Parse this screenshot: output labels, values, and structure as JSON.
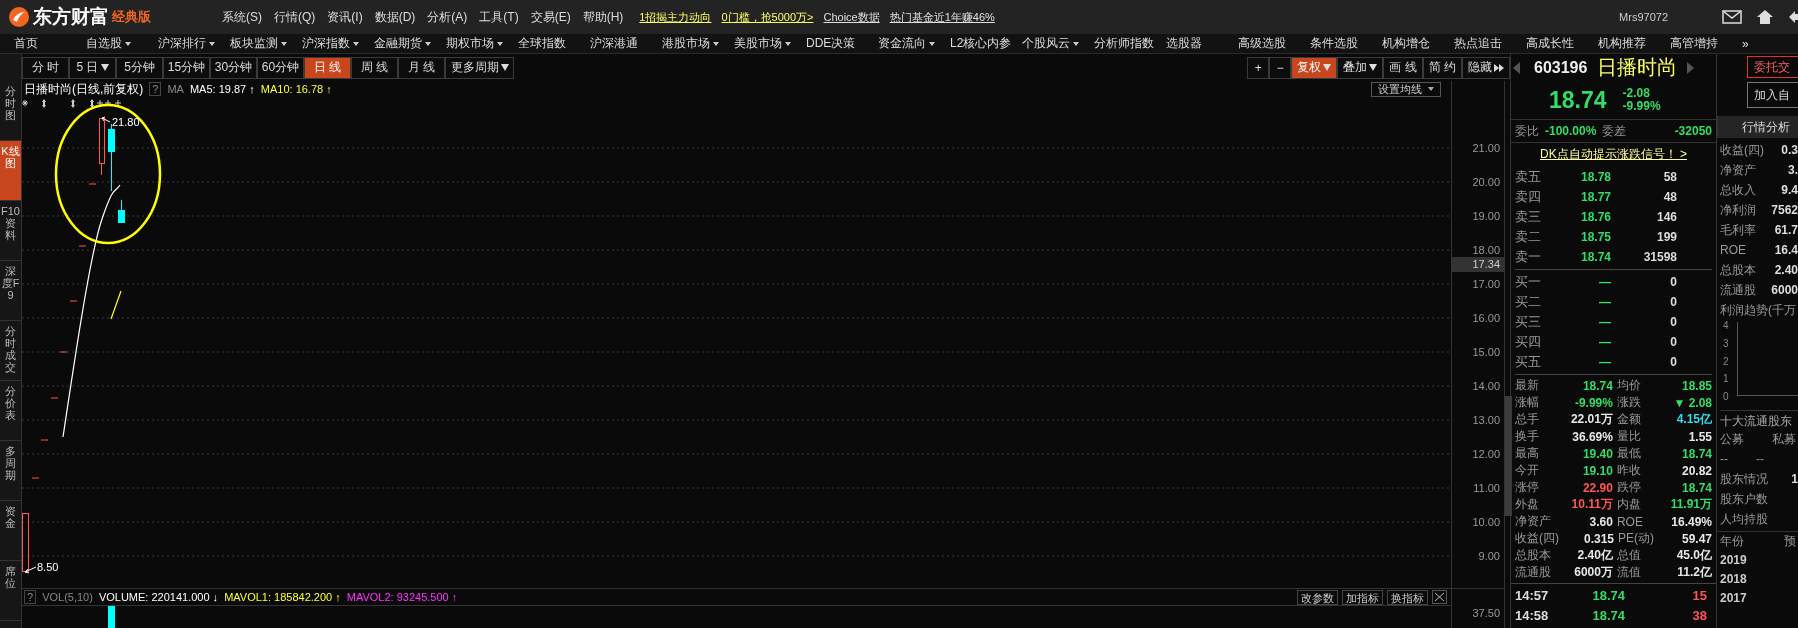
{
  "app": {
    "brand": "东方财富",
    "edition": "经典版"
  },
  "menu": [
    "系统(S)",
    "行情(Q)",
    "资讯(I)",
    "数据(D)",
    "分析(A)",
    "工具(T)",
    "交易(E)",
    "帮助(H)"
  ],
  "promo_links": [
    {
      "label": "1招揭主力动向",
      "color": "#ffff66"
    },
    {
      "label": "0门槛，抢5000万>",
      "color": "#ffff66"
    },
    {
      "label": "Choice数据",
      "color": "#e0e0e0"
    },
    {
      "label": "热门基金近1年赚46%",
      "color": "#e0e0e0"
    }
  ],
  "user": "Mrs97072",
  "nav": [
    {
      "label": "首页",
      "dropdown": false
    },
    {
      "label": "自选股",
      "dropdown": true
    },
    {
      "label": "沪深排行",
      "dropdown": true
    },
    {
      "label": "板块监测",
      "dropdown": true
    },
    {
      "label": "沪深指数",
      "dropdown": true
    },
    {
      "label": "金融期货",
      "dropdown": true
    },
    {
      "label": "期权市场",
      "dropdown": true
    },
    {
      "label": "全球指数",
      "dropdown": false
    },
    {
      "label": "沪深港通",
      "dropdown": false
    },
    {
      "label": "港股市场",
      "dropdown": true
    },
    {
      "label": "美股市场",
      "dropdown": true
    },
    {
      "label": "DDE决策",
      "dropdown": false
    },
    {
      "label": "资金流向",
      "dropdown": true
    },
    {
      "label": "L2核心内参",
      "dropdown": false
    },
    {
      "label": "个股风云",
      "dropdown": true
    },
    {
      "label": "分析师指数",
      "dropdown": false
    },
    {
      "label": "选股器",
      "dropdown": false
    },
    {
      "label": "高级选股",
      "dropdown": false
    },
    {
      "label": "条件选股",
      "dropdown": false
    },
    {
      "label": "机构增仓",
      "dropdown": false
    },
    {
      "label": "热点追击",
      "dropdown": false
    },
    {
      "label": "高成长性",
      "dropdown": false
    },
    {
      "label": "机构推荐",
      "dropdown": false
    },
    {
      "label": "高管增持",
      "dropdown": false
    },
    {
      "label": "»",
      "dropdown": false
    }
  ],
  "side_tabs": [
    {
      "label": "分时图",
      "selected": false
    },
    {
      "label": "K线图",
      "selected": true
    },
    {
      "label": "F10资料",
      "selected": false
    },
    {
      "label": "深度F9",
      "selected": false
    },
    {
      "label": "分时成交",
      "selected": false
    },
    {
      "label": "分价表",
      "selected": false
    },
    {
      "label": "多周期",
      "selected": false
    },
    {
      "label": "资金",
      "selected": false
    },
    {
      "label": "席位",
      "selected": false
    }
  ],
  "periods": [
    {
      "label": "分 时",
      "selected": false,
      "dropdown": false
    },
    {
      "label": "5 日",
      "selected": false,
      "dropdown": true
    },
    {
      "label": "5分钟",
      "selected": false,
      "dropdown": false
    },
    {
      "label": "15分钟",
      "selected": false,
      "dropdown": false
    },
    {
      "label": "30分钟",
      "selected": false,
      "dropdown": false
    },
    {
      "label": "60分钟",
      "selected": false,
      "dropdown": false
    },
    {
      "label": "日 线",
      "selected": true,
      "dropdown": false
    },
    {
      "label": "周 线",
      "selected": false,
      "dropdown": false
    },
    {
      "label": "月 线",
      "selected": false,
      "dropdown": false
    },
    {
      "label": "更多周期",
      "selected": false,
      "dropdown": true
    }
  ],
  "chart_tools": [
    {
      "label": "+",
      "selected": false,
      "kind": "plain"
    },
    {
      "label": "−",
      "selected": false,
      "kind": "plain"
    },
    {
      "label": "复权",
      "selected": true,
      "kind": "dropdown"
    },
    {
      "label": "叠加",
      "selected": false,
      "kind": "dropdown"
    },
    {
      "label": "画 线",
      "selected": false,
      "kind": "plain"
    },
    {
      "label": "简 约",
      "selected": false,
      "kind": "plain"
    },
    {
      "label": "隐藏",
      "selected": false,
      "kind": "expand"
    }
  ],
  "chart": {
    "title": "日播时尚",
    "subtitle": "(日线,前复权)",
    "help": "?",
    "ma_label": "MA",
    "ma": [
      {
        "text": "MA5: 19.87 ↑",
        "color": "#ffffff"
      },
      {
        "text": "MA10: 16.78 ↑",
        "color": "#ffff33"
      }
    ],
    "ma_setting": "设置均线",
    "high_label": "21.80",
    "low_label": "8.50",
    "price_axis": [
      "21.00",
      "20.00",
      "19.00",
      "18.00",
      "17.00",
      "16.00",
      "15.00",
      "14.00",
      "13.00",
      "12.00",
      "11.00",
      "10.00",
      "9.00"
    ],
    "current_price_tag": "17.34"
  },
  "volume": {
    "help": "?",
    "name": "VOL(5,10)",
    "values": [
      {
        "text": "VOLUME: 220141.000 ↓",
        "color": "#ffffff"
      },
      {
        "text": "MAVOL1: 185842.200 ↑",
        "color": "#ffff33"
      },
      {
        "text": "MAVOL2: 93245.500 ↑",
        "color": "#ff33ff"
      }
    ],
    "buttons": [
      "改参数",
      "加指标",
      "换指标"
    ],
    "axis": "37.50"
  },
  "quote": {
    "code": "603196",
    "name": "日播时尚",
    "price": "18.74",
    "change": "-2.08",
    "change_pct": "-9.99%",
    "ratio_label": "委比",
    "ratio": "-100.00%",
    "diff_label": "委差",
    "diff": "-32050",
    "signal_link": "DK点自动提示涨跌信号！ >",
    "asks": [
      {
        "label": "卖五",
        "price": "18.78",
        "volume": "58"
      },
      {
        "label": "卖四",
        "price": "18.77",
        "volume": "48"
      },
      {
        "label": "卖三",
        "price": "18.76",
        "volume": "146"
      },
      {
        "label": "卖二",
        "price": "18.75",
        "volume": "199"
      },
      {
        "label": "卖一",
        "price": "18.74",
        "volume": "31598"
      }
    ],
    "bids": [
      {
        "label": "买一",
        "price": "—",
        "volume": "0"
      },
      {
        "label": "买二",
        "price": "—",
        "volume": "0"
      },
      {
        "label": "买三",
        "price": "—",
        "volume": "0"
      },
      {
        "label": "买四",
        "price": "—",
        "volume": "0"
      },
      {
        "label": "买五",
        "price": "—",
        "volume": "0"
      }
    ],
    "stats": [
      {
        "cells": [
          {
            "label": "最新",
            "value": "18.74",
            "color": "#33dd66"
          },
          {
            "label": "均价",
            "value": "18.85",
            "color": "#33dd66"
          }
        ]
      },
      {
        "cells": [
          {
            "label": "涨幅",
            "value": "-9.99%",
            "color": "#33dd66"
          },
          {
            "label": "涨跌",
            "value": "▼ 2.08",
            "color": "#33dd66"
          }
        ]
      },
      {
        "cells": [
          {
            "label": "总手",
            "value": "22.01万",
            "color": "#e8e8e8"
          },
          {
            "label": "金额",
            "value": "4.15亿",
            "color": "#33ddee"
          }
        ]
      },
      {
        "cells": [
          {
            "label": "换手",
            "value": "36.69%",
            "color": "#e8e8e8"
          },
          {
            "label": "量比",
            "value": "1.55",
            "color": "#e8e8e8"
          }
        ]
      },
      {
        "cells": [
          {
            "label": "最高",
            "value": "19.40",
            "color": "#33dd66"
          },
          {
            "label": "最低",
            "value": "18.74",
            "color": "#33dd66"
          }
        ]
      },
      {
        "cells": [
          {
            "label": "今开",
            "value": "19.10",
            "color": "#33dd66"
          },
          {
            "label": "昨收",
            "value": "20.82",
            "color": "#e8e8e8"
          }
        ]
      },
      {
        "cells": [
          {
            "label": "涨停",
            "value": "22.90",
            "color": "#ff5555"
          },
          {
            "label": "跌停",
            "value": "18.74",
            "color": "#33dd66"
          }
        ]
      },
      {
        "cells": [
          {
            "label": "外盘",
            "value": "10.11万",
            "color": "#ff5555"
          },
          {
            "label": "内盘",
            "value": "11.91万",
            "color": "#33dd66"
          }
        ]
      },
      {
        "cells": [
          {
            "label": "净资产",
            "value": "3.60",
            "color": "#e8e8e8"
          },
          {
            "label": "ROE",
            "value": "16.49%",
            "color": "#e8e8e8"
          }
        ]
      },
      {
        "cells": [
          {
            "label": "收益(四)",
            "value": "0.315",
            "color": "#e8e8e8"
          },
          {
            "label": "PE(动)",
            "value": "59.47",
            "color": "#e8e8e8"
          }
        ]
      },
      {
        "cells": [
          {
            "label": "总股本",
            "value": "2.40亿",
            "color": "#e8e8e8"
          },
          {
            "label": "总值",
            "value": "45.0亿",
            "color": "#e8e8e8"
          }
        ]
      },
      {
        "cells": [
          {
            "label": "流通股",
            "value": "6000万",
            "color": "#e8e8e8"
          },
          {
            "label": "流值",
            "value": "11.2亿",
            "color": "#e8e8e8"
          }
        ]
      }
    ],
    "ticks": [
      {
        "time": "14:57",
        "price": "18.74",
        "volume": "15"
      },
      {
        "time": "14:58",
        "price": "18.74",
        "volume": "38"
      }
    ]
  },
  "side": {
    "trade_button": "委托交",
    "watch_button": "加入自",
    "tab": "行情分析",
    "fundamentals": [
      {
        "label": "收益(四)",
        "value": "0.3"
      },
      {
        "label": "净资产",
        "value": "3."
      },
      {
        "label": "总收入",
        "value": "9.4"
      },
      {
        "label": "净利润",
        "value": "7562"
      },
      {
        "label": "毛利率",
        "value": "61.7"
      },
      {
        "label": "ROE",
        "value": "16.4"
      },
      {
        "label": "总股本",
        "value": "2.40"
      },
      {
        "label": "流通股",
        "value": "6000"
      }
    ],
    "profit_trend": "利润趋势(千万",
    "profit_axis": [
      "4",
      "3",
      "2",
      "1",
      "0"
    ],
    "holders_title": "十大流通股东",
    "holder_cols": [
      "公募",
      "私募"
    ],
    "holder_vals": [
      "--",
      "--"
    ],
    "holder_rows": [
      {
        "label": "股东情况",
        "value": "1"
      },
      {
        "label": "股东户数",
        "value": ""
      },
      {
        "label": "人均持股",
        "value": ""
      }
    ],
    "year_header": [
      "年份",
      "预"
    ],
    "years": [
      "2019",
      "2018",
      "2017"
    ]
  }
}
